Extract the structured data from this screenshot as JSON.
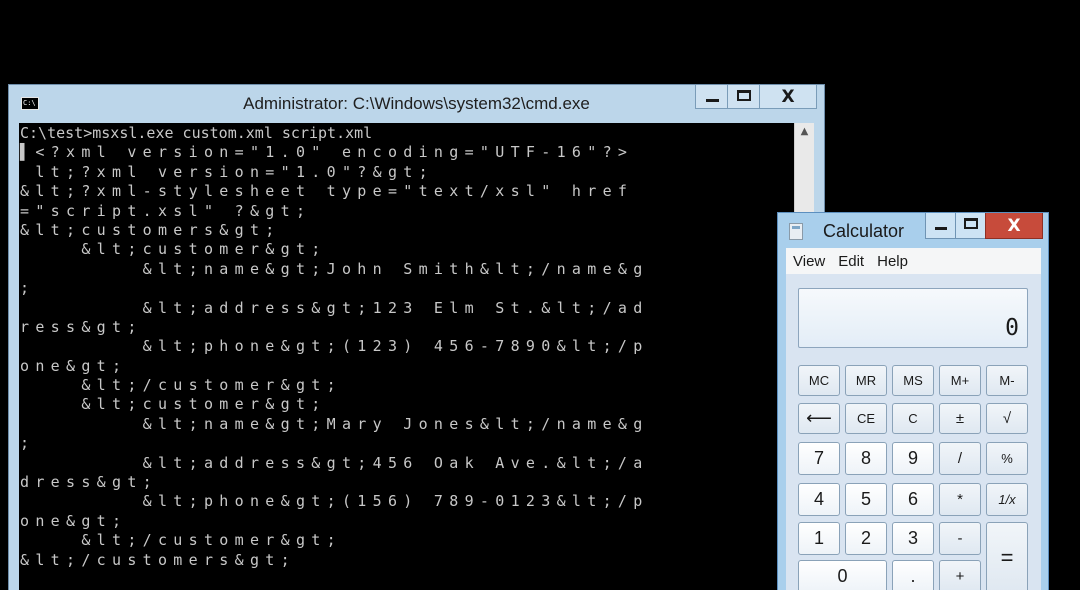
{
  "cmd": {
    "title": "Administrator: C:\\Windows\\system32\\cmd.exe",
    "sys_icon_label": "C:\\",
    "lines": [
      "C:\\test>msxsl.exe custom.xml script.xml",
      "▌<?xml version=\"1.0\" encoding=\"UTF-16\"?>",
      " lt;?xml version=\"1.0\"?&gt;",
      "&lt;?xml-stylesheet type=\"text/xsl\" href",
      "=\"script.xsl\" ?&gt;",
      "&lt;customers&gt;",
      "    &lt;customer&gt;",
      "        &lt;name&gt;John Smith&lt;/name&g",
      ";",
      "        &lt;address&gt;123 Elm St.&lt;/ad",
      "ress&gt;",
      "        &lt;phone&gt;(123) 456-7890&lt;/p",
      "one&gt;",
      "    &lt;/customer&gt;",
      "    &lt;customer&gt;",
      "        &lt;name&gt;Mary Jones&lt;/name&g",
      ";",
      "        &lt;address&gt;456 Oak Ave.&lt;/a",
      "dress&gt;",
      "        &lt;phone&gt;(156) 789-0123&lt;/p",
      "one&gt;",
      "    &lt;/customer&gt;",
      "&lt;/customers&gt;"
    ]
  },
  "calculator": {
    "title": "Calculator",
    "menu": [
      "View",
      "Edit",
      "Help"
    ],
    "display": "0",
    "keys": {
      "mc": "MC",
      "mr": "MR",
      "ms": "MS",
      "mplus": "M+",
      "mminus": "M-",
      "back": "⟵",
      "ce": "CE",
      "c": "C",
      "plusminus": "±",
      "sqrt": "√",
      "seven": "7",
      "eight": "8",
      "nine": "9",
      "divide": "/",
      "percent": "%",
      "four": "4",
      "five": "5",
      "six": "6",
      "multiply": "*",
      "reciprocal": "1/x",
      "one": "1",
      "two": "2",
      "three": "3",
      "minus": "-",
      "zero": "0",
      "dot": ".",
      "plus": "+",
      "equals": "="
    }
  },
  "icons": {
    "minimize": "minimize-icon",
    "maximize": "maximize-icon",
    "close": "close-icon",
    "close_glyph": "X"
  }
}
